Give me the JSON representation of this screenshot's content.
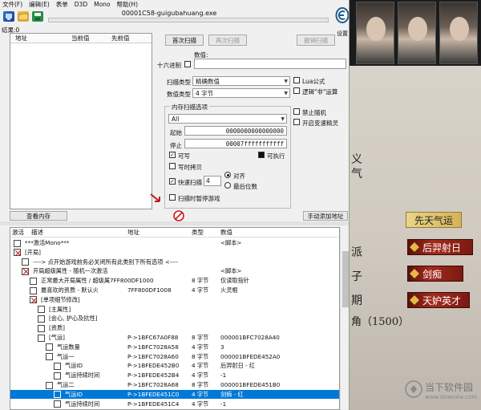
{
  "menu": [
    "文件(F)",
    "编辑(E)",
    "表单",
    "D3D",
    "Mono",
    "帮助(H)"
  ],
  "process_title": "00001C58-guigubahuang.exe",
  "settings_label": "设置",
  "found_label": "结果:0",
  "result_columns": [
    "地址",
    "当前值",
    "先前值"
  ],
  "buttons": {
    "first_scan": "首次扫描",
    "next_scan": "再次扫描",
    "undo_scan": "撤销扫描",
    "view_memory": "查看内存",
    "add_manual": "手动添加地址"
  },
  "scan": {
    "value_label": "数值:",
    "hex_label": "十六进制",
    "scan_type_label": "扫描类型",
    "scan_type_value": "精确数值",
    "value_type_label": "数值类型",
    "value_type_value": "4 字节",
    "memory_options_label": "内存扫描选项",
    "region_value": "All",
    "start_label": "起始",
    "start_value": "0000000000000000",
    "stop_label": "停止",
    "stop_value": "00007fffffffffff",
    "writable_label": "可写",
    "executable_label": "可执行",
    "copy_on_write_label": "写时拷贝",
    "fast_scan_label": "快速扫描",
    "fast_scan_value": "4",
    "align_label": "对齐",
    "last_digits_label": "最后位数",
    "pause_game_label": "扫描时暂停游戏",
    "lua_label": "Lua公式",
    "logic_not_label": "逻辑\"非\"运算",
    "disable_random_label": "禁止随机",
    "speedhack_label": "开启变速精灵"
  },
  "table_columns": [
    "激活",
    "描述",
    "地址",
    "类型",
    "数值"
  ],
  "table_rows": [
    {
      "checked": false,
      "indent": 0,
      "desc": "***激活Mono***",
      "addr": "",
      "type": "",
      "value": "<脚本>"
    },
    {
      "checked": true,
      "indent": 0,
      "desc": "[开局]",
      "addr": "",
      "type": "",
      "value": ""
    },
    {
      "checked": false,
      "indent": 1,
      "desc": "---->      点开始游戏前务必关闭所有此类别下所有选项      <----",
      "addr": "",
      "type": "",
      "value": ""
    },
    {
      "checked": true,
      "indent": 1,
      "desc": "开局超级属性 - 随机一次激活",
      "addr": "",
      "type": "",
      "value": "<脚本>"
    },
    {
      "checked": false,
      "indent": 2,
      "desc": "正常最大开局属性 / 超级属7FF800DF1000",
      "addr": "",
      "type": "8 字节",
      "value": "仅读取指针"
    },
    {
      "checked": false,
      "indent": 2,
      "desc": "最喜欢的资质 - 默认火",
      "addr": "7FF800DF1008",
      "type": "4 字节",
      "value": "火灵根"
    },
    {
      "checked": true,
      "indent": 2,
      "desc": "[单项细节修改]",
      "addr": "",
      "type": "",
      "value": ""
    },
    {
      "checked": false,
      "indent": 3,
      "desc": "[主属性]",
      "addr": "",
      "type": "",
      "value": ""
    },
    {
      "checked": false,
      "indent": 3,
      "desc": "[会心, 护心及抗性]",
      "addr": "",
      "type": "",
      "value": ""
    },
    {
      "checked": false,
      "indent": 3,
      "desc": "[资质]",
      "addr": "",
      "type": "",
      "value": ""
    },
    {
      "checked": false,
      "indent": 3,
      "desc": "[气运]",
      "addr": "P->1BFC67A0F88",
      "type": "8 字节",
      "value": "000001BFC7028A40"
    },
    {
      "checked": false,
      "indent": 4,
      "desc": "气运数量",
      "addr": "P->1BFC7028A58",
      "type": "4 字节",
      "value": "3"
    },
    {
      "checked": false,
      "indent": 4,
      "desc": "气运一",
      "addr": "P->1BFC7028A60",
      "type": "8 字节",
      "value": "000001BFEDE452A0"
    },
    {
      "checked": false,
      "indent": 5,
      "desc": "气运ID",
      "addr": "P->1BFEDE452B0",
      "type": "4 字节",
      "value": "后羿射日 - 红"
    },
    {
      "checked": false,
      "indent": 5,
      "desc": "气运持续时间",
      "addr": "P->1BFEDE452B4",
      "type": "4 字节",
      "value": "-1"
    },
    {
      "checked": false,
      "indent": 4,
      "desc": "气运二",
      "addr": "P->1BFC7028A68",
      "type": "8 字节",
      "value": "000001BFEDE451B0"
    },
    {
      "checked": false,
      "indent": 5,
      "desc": "气运ID",
      "addr": "P->1BFEDE451C0",
      "type": "4 字节",
      "value": "剑痴 - 红",
      "selected": true
    },
    {
      "checked": false,
      "indent": 5,
      "desc": "气运持续时间",
      "addr": "P->1BFEDE451C4",
      "type": "4 字节",
      "value": "-1"
    }
  ],
  "game": {
    "skill_gold": "先天气运",
    "skills": [
      "后羿射日",
      "剑痴",
      "天妒英才"
    ],
    "labels": [
      "义",
      "气",
      "派",
      "子",
      "期",
      "角（1500）"
    ]
  },
  "watermark": "当下软件园",
  "watermark_url": "www.downxia.com",
  "colors": {
    "selection": "#0078d7",
    "skill_red": "#a52a1c",
    "skill_gold": "#e0c56e"
  }
}
